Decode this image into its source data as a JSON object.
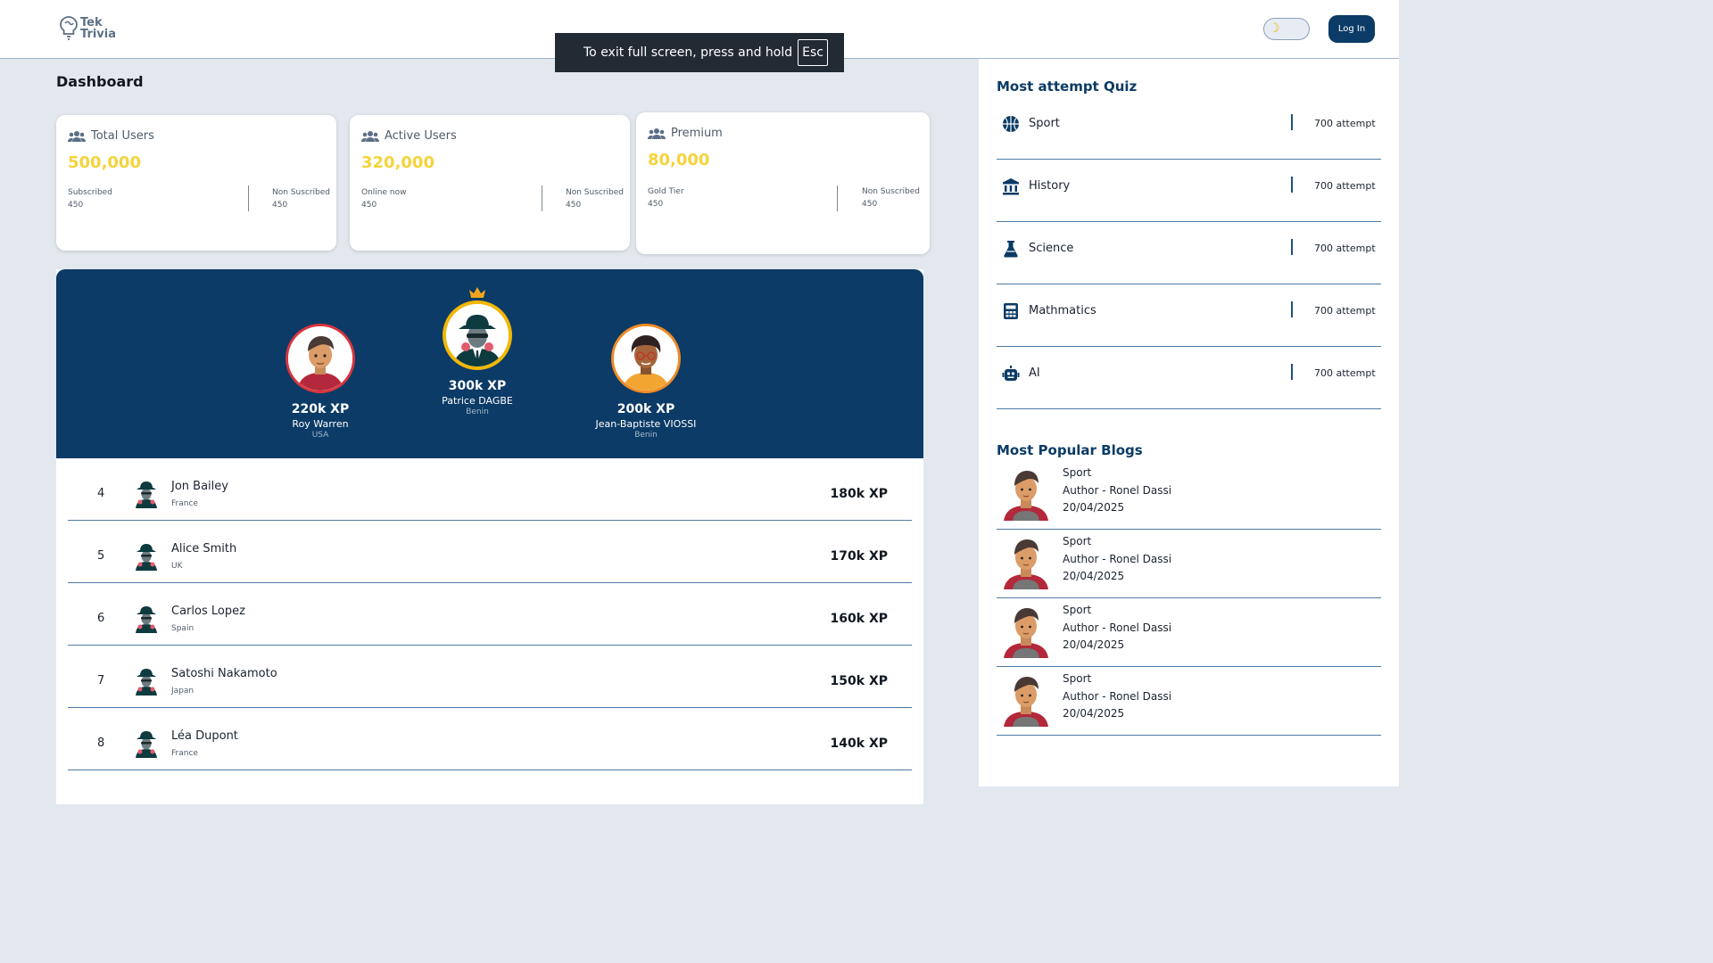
{
  "app": {
    "logo_line1": "Tek",
    "logo_line2": "Trivia"
  },
  "header": {
    "login_label": "Log In",
    "theme_icon": "moon-icon"
  },
  "fullscreen_toast": {
    "message": "To exit full screen, press and hold",
    "key": "Esc"
  },
  "page": {
    "title": "Dashboard"
  },
  "stats": [
    {
      "title": "Total Users",
      "value": "500,000",
      "left_label": "Subscribed",
      "left_value": "450",
      "right_label": "Non Suscribed",
      "right_value": "450"
    },
    {
      "title": "Active Users",
      "value": "320,000",
      "left_label": "Online now",
      "left_value": "450",
      "right_label": "Non Suscribed",
      "right_value": "450"
    },
    {
      "title": "Premium",
      "value": "80,000",
      "left_label": "Gold Tier",
      "left_value": "450",
      "right_label": "Non Suscribed",
      "right_value": "450"
    }
  ],
  "podium": [
    {
      "xp": "220k XP",
      "name": "Roy Warren",
      "country": "USA",
      "ring": "#d9343f"
    },
    {
      "xp": "300k XP",
      "name": "Patrice DAGBE",
      "country": "Benin",
      "ring": "#f2b705"
    },
    {
      "xp": "200k XP",
      "name": "Jean-Baptiste VIOSSI",
      "country": "Benin",
      "ring": "#f08a24"
    }
  ],
  "ranking": [
    {
      "rank": "4",
      "name": "Jon Bailey",
      "country": "France",
      "xp": "180k XP"
    },
    {
      "rank": "5",
      "name": "Alice Smith",
      "country": "UK",
      "xp": "170k XP"
    },
    {
      "rank": "6",
      "name": "Carlos Lopez",
      "country": "Spain",
      "xp": "160k XP"
    },
    {
      "rank": "7",
      "name": "Satoshi Nakamoto",
      "country": "Japan",
      "xp": "150k XP"
    },
    {
      "rank": "8",
      "name": "Léa Dupont",
      "country": "France",
      "xp": "140k XP"
    }
  ],
  "side": {
    "quiz_title": "Most attempt Quiz",
    "quizzes": [
      {
        "label": "Sport",
        "count": "700 attempt",
        "icon": "basketball-icon"
      },
      {
        "label": "History",
        "count": "700 attempt",
        "icon": "museum-icon"
      },
      {
        "label": "Science",
        "count": "700 attempt",
        "icon": "flask-icon"
      },
      {
        "label": "Mathmatics",
        "count": "700 attempt",
        "icon": "calculator-icon"
      },
      {
        "label": "AI",
        "count": "700 attempt",
        "icon": "robot-icon"
      }
    ],
    "blogs_title": "Most Popular Blogs",
    "blogs": [
      {
        "category": "Sport",
        "author": "Author - Ronel Dassi",
        "date": "20/04/2025"
      },
      {
        "category": "Sport",
        "author": "Author - Ronel Dassi",
        "date": "20/04/2025"
      },
      {
        "category": "Sport",
        "author": "Author - Ronel Dassi",
        "date": "20/04/2025"
      },
      {
        "category": "Sport",
        "author": "Author - Ronel Dassi",
        "date": "20/04/2025"
      }
    ]
  },
  "colors": {
    "primary": "#0b3b66",
    "accent_value": "#f5d33a",
    "background": "#e3e8ef"
  }
}
